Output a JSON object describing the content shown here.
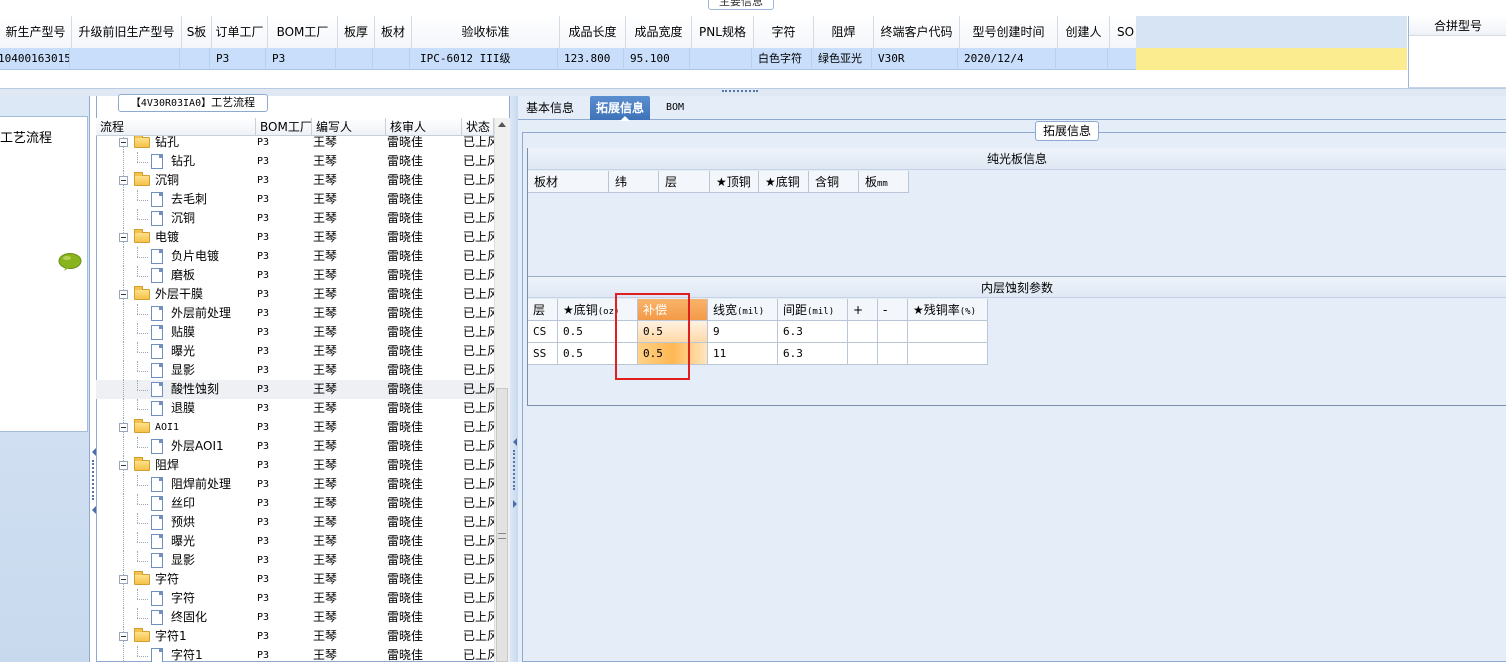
{
  "top": {
    "title": "主要信息",
    "columns": [
      "新生产型号",
      "升级前旧生产型号",
      "S板",
      "订单工厂",
      "BOM工厂",
      "板厚",
      "板材",
      "验收标准",
      "成品长度",
      "成品宽度",
      "PNL规格",
      "字符",
      "阻焊",
      "终端客户代码",
      "型号创建时间",
      "创建人",
      "SO"
    ],
    "row": [
      "10400163015",
      "",
      "",
      "P3",
      "P3",
      "",
      "",
      "IPC-6012 III级",
      "123.800",
      "95.100",
      "",
      "白色字符",
      "绿色亚光",
      "V30R",
      "2020/12/4",
      "",
      ""
    ],
    "merge_header": "合拼型号"
  },
  "left": {
    "item": "工艺流程",
    "icon": "chat-bubble-icon"
  },
  "tree": {
    "title_code": "【4V30R03IA0】",
    "title_text": "工艺流程",
    "columns": [
      "流程",
      "BOM工厂",
      "编写人",
      "核审人",
      "状态"
    ],
    "rows": [
      {
        "name": "钻孔",
        "type": "folder",
        "bom": "P3",
        "writer": "王琴",
        "reviewer": "雷晓佳",
        "status": "已上风"
      },
      {
        "name": "钻孔",
        "type": "doc",
        "bom": "P3",
        "writer": "王琴",
        "reviewer": "雷晓佳",
        "status": "已上风"
      },
      {
        "name": "沉铜",
        "type": "folder",
        "bom": "P3",
        "writer": "王琴",
        "reviewer": "雷晓佳",
        "status": "已上风"
      },
      {
        "name": "去毛刺",
        "type": "doc",
        "bom": "P3",
        "writer": "王琴",
        "reviewer": "雷晓佳",
        "status": "已上风"
      },
      {
        "name": "沉铜",
        "type": "doc",
        "bom": "P3",
        "writer": "王琴",
        "reviewer": "雷晓佳",
        "status": "已上风"
      },
      {
        "name": "电镀",
        "type": "folder",
        "bom": "P3",
        "writer": "王琴",
        "reviewer": "雷晓佳",
        "status": "已上风"
      },
      {
        "name": "负片电镀",
        "type": "doc",
        "bom": "P3",
        "writer": "王琴",
        "reviewer": "雷晓佳",
        "status": "已上风"
      },
      {
        "name": "磨板",
        "type": "doc",
        "bom": "P3",
        "writer": "王琴",
        "reviewer": "雷晓佳",
        "status": "已上风"
      },
      {
        "name": "外层干膜",
        "type": "folder",
        "bom": "P3",
        "writer": "王琴",
        "reviewer": "雷晓佳",
        "status": "已上风"
      },
      {
        "name": "外层前处理",
        "type": "doc",
        "bom": "P3",
        "writer": "王琴",
        "reviewer": "雷晓佳",
        "status": "已上风"
      },
      {
        "name": "贴膜",
        "type": "doc",
        "bom": "P3",
        "writer": "王琴",
        "reviewer": "雷晓佳",
        "status": "已上风"
      },
      {
        "name": "曝光",
        "type": "doc",
        "bom": "P3",
        "writer": "王琴",
        "reviewer": "雷晓佳",
        "status": "已上风"
      },
      {
        "name": "显影",
        "type": "doc",
        "bom": "P3",
        "writer": "王琴",
        "reviewer": "雷晓佳",
        "status": "已上风"
      },
      {
        "name": "酸性蚀刻",
        "type": "doc",
        "bom": "P3",
        "writer": "王琴",
        "reviewer": "雷晓佳",
        "status": "已上风",
        "selected": true
      },
      {
        "name": "退膜",
        "type": "doc",
        "bom": "P3",
        "writer": "王琴",
        "reviewer": "雷晓佳",
        "status": "已上风"
      },
      {
        "name": "AOI1",
        "type": "folder",
        "bom": "P3",
        "writer": "王琴",
        "reviewer": "雷晓佳",
        "status": "已上风"
      },
      {
        "name": "外层AOI1",
        "type": "doc",
        "bom": "P3",
        "writer": "王琴",
        "reviewer": "雷晓佳",
        "status": "已上风"
      },
      {
        "name": "阻焊",
        "type": "folder",
        "bom": "P3",
        "writer": "王琴",
        "reviewer": "雷晓佳",
        "status": "已上风"
      },
      {
        "name": "阻焊前处理",
        "type": "doc",
        "bom": "P3",
        "writer": "王琴",
        "reviewer": "雷晓佳",
        "status": "已上风"
      },
      {
        "name": "丝印",
        "type": "doc",
        "bom": "P3",
        "writer": "王琴",
        "reviewer": "雷晓佳",
        "status": "已上风"
      },
      {
        "name": "预烘",
        "type": "doc",
        "bom": "P3",
        "writer": "王琴",
        "reviewer": "雷晓佳",
        "status": "已上风"
      },
      {
        "name": "曝光",
        "type": "doc",
        "bom": "P3",
        "writer": "王琴",
        "reviewer": "雷晓佳",
        "status": "已上风"
      },
      {
        "name": "显影",
        "type": "doc",
        "bom": "P3",
        "writer": "王琴",
        "reviewer": "雷晓佳",
        "status": "已上风"
      },
      {
        "name": "字符",
        "type": "folder",
        "bom": "P3",
        "writer": "王琴",
        "reviewer": "雷晓佳",
        "status": "已上风"
      },
      {
        "name": "字符",
        "type": "doc",
        "bom": "P3",
        "writer": "王琴",
        "reviewer": "雷晓佳",
        "status": "已上风"
      },
      {
        "name": "终固化",
        "type": "doc",
        "bom": "P3",
        "writer": "王琴",
        "reviewer": "雷晓佳",
        "status": "已上风"
      },
      {
        "name": "字符1",
        "type": "folder",
        "bom": "P3",
        "writer": "王琴",
        "reviewer": "雷晓佳",
        "status": "已上风"
      },
      {
        "name": "字符1",
        "type": "doc",
        "bom": "P3",
        "writer": "王琴",
        "reviewer": "雷晓佳",
        "status": "已上风"
      }
    ]
  },
  "tabs": {
    "basic": "基本信息",
    "ext": "拓展信息",
    "bom": "BOM"
  },
  "ext": {
    "title": "拓展信息",
    "bare_title": "纯光板信息",
    "bare_cols": [
      {
        "label": "板材",
        "unit": ""
      },
      {
        "label": "纬",
        "unit": ""
      },
      {
        "label": "层",
        "unit": ""
      },
      {
        "label": "★顶铜",
        "unit": ""
      },
      {
        "label": "★底铜",
        "unit": ""
      },
      {
        "label": "含铜",
        "unit": ""
      },
      {
        "label": "板",
        "unit": "mm"
      }
    ],
    "inner_title": "内层蚀刻参数",
    "inner_cols": [
      {
        "label": "层",
        "unit": ""
      },
      {
        "label": "★底铜",
        "unit": "(oz)"
      },
      {
        "label": "补偿",
        "unit": ""
      },
      {
        "label": "线宽",
        "unit": "(mil)"
      },
      {
        "label": "间距",
        "unit": "(mil)"
      },
      {
        "label": "+",
        "unit": ""
      },
      {
        "label": "-",
        "unit": ""
      },
      {
        "label": "★残铜率",
        "unit": "(%)"
      }
    ],
    "inner_rows": [
      [
        "CS",
        "0.5",
        "0.5",
        "9",
        "6.3",
        "",
        "",
        ""
      ],
      [
        "SS",
        "0.5",
        "0.5",
        "11",
        "6.3",
        "",
        "",
        ""
      ]
    ]
  },
  "colors": {
    "selected_row": "#c8defa",
    "highlight": "#f39a48",
    "annotation": "#e02020"
  }
}
